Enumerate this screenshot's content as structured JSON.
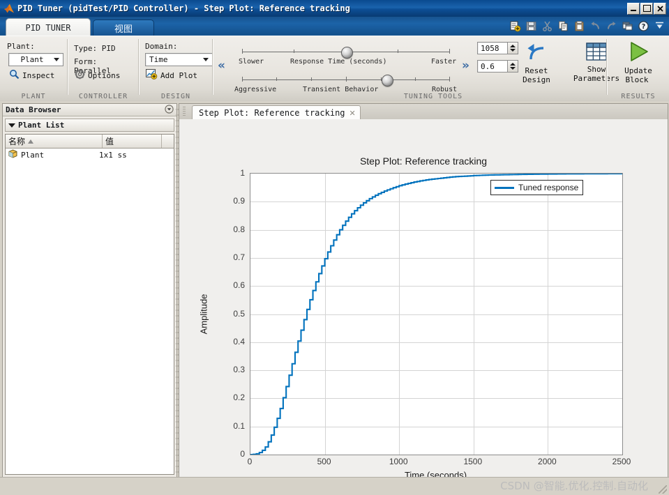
{
  "window": {
    "title": "PID Tuner  (pidTest/PID Controller) - Step Plot: Reference tracking",
    "icon": "matlab-logo-icon",
    "minimize": "_",
    "maximize": "□",
    "close": "✕"
  },
  "ribbon": {
    "tabs": [
      {
        "label": "PID TUNER",
        "active": true
      },
      {
        "label": "视图",
        "active": false
      }
    ],
    "quick_access": [
      "new-icon",
      "save-icon",
      "cut-icon",
      "copy-icon",
      "paste-icon",
      "undo-icon",
      "redo-icon",
      "window-icon",
      "help-icon",
      "collapse-ribbon-icon"
    ],
    "groups": [
      {
        "name": "PLANT",
        "label": "Plant:",
        "combo_value": "Plant",
        "inspect_label": "Inspect",
        "inspect_icon": "magnifier-icon"
      },
      {
        "name": "CONTROLLER",
        "type_label": "Type:",
        "type_value": "PID",
        "form_label": "Form:",
        "form_value": "Parallel",
        "options_label": "Options",
        "options_icon": "gear-icon"
      },
      {
        "name": "DESIGN",
        "domain_label": "Domain:",
        "domain_value": "Time",
        "add_plot_label": "Add Plot",
        "add_plot_icon": "plot-add-icon"
      },
      {
        "name": "TUNING TOOLS",
        "slider1": {
          "left_label": "Slower",
          "center_label": "Response Time (seconds)",
          "right_label": "Faster",
          "position_pct": 50
        },
        "slider2": {
          "left_label": "Aggressive",
          "center_label": "Transient Behavior",
          "right_label": "Robust",
          "position_pct": 72
        },
        "left_chevron": "«",
        "right_chevron": "»",
        "response_time_value": "1058",
        "transient_value": "0.6",
        "reset_design_line1": "Reset",
        "reset_design_line2": "Design",
        "reset_icon": "undo-arrow-icon",
        "show_parameters_line1": "Show",
        "show_parameters_line2": "Parameters",
        "show_parameters_icon": "table-icon"
      },
      {
        "name": "RESULTS",
        "update_block_line1": "Update",
        "update_block_line2": "Block",
        "update_icon": "green-play-icon"
      }
    ]
  },
  "data_browser": {
    "title": "Data Browser",
    "collapse_icon": "panel-collapse-icon",
    "section": "Plant List",
    "columns": [
      "名称",
      "值",
      ""
    ],
    "rows": [
      {
        "icon": "model-cube-icon",
        "name": "Plant",
        "value": "1x1 ss"
      }
    ]
  },
  "document": {
    "tab_label": "Step Plot: Reference tracking",
    "close_icon": "close-tab-icon"
  },
  "chart_data": {
    "type": "line",
    "title": "Step Plot: Reference tracking",
    "xlabel": "Time (seconds)",
    "ylabel": "Amplitude",
    "xlim": [
      0,
      2500
    ],
    "ylim": [
      0,
      1
    ],
    "xticks": [
      0,
      500,
      1000,
      1500,
      2000,
      2500
    ],
    "yticks": [
      0,
      0.1,
      0.2,
      0.3,
      0.4,
      0.5,
      0.6,
      0.7,
      0.8,
      0.9,
      1
    ],
    "grid": true,
    "legend_position": "top-right",
    "series": [
      {
        "name": "Tuned response",
        "color": "#0072BD",
        "x": [
          0,
          25,
          50,
          75,
          100,
          125,
          150,
          175,
          200,
          225,
          250,
          275,
          300,
          325,
          350,
          375,
          400,
          425,
          450,
          475,
          500,
          525,
          550,
          575,
          600,
          625,
          650,
          675,
          700,
          725,
          750,
          775,
          800,
          850,
          900,
          950,
          1000,
          1050,
          1100,
          1150,
          1200,
          1250,
          1300,
          1350,
          1400,
          1450,
          1500,
          1600,
          1700,
          1800,
          1900,
          2000,
          2100,
          2200,
          2300,
          2400,
          2500
        ],
        "y": [
          0,
          0.001,
          0.004,
          0.012,
          0.027,
          0.05,
          0.082,
          0.12,
          0.164,
          0.212,
          0.262,
          0.313,
          0.364,
          0.414,
          0.462,
          0.508,
          0.551,
          0.592,
          0.63,
          0.665,
          0.697,
          0.727,
          0.754,
          0.778,
          0.8,
          0.82,
          0.838,
          0.854,
          0.868,
          0.881,
          0.892,
          0.902,
          0.911,
          0.926,
          0.938,
          0.948,
          0.957,
          0.964,
          0.97,
          0.975,
          0.979,
          0.982,
          0.985,
          0.988,
          0.99,
          0.991,
          0.993,
          0.995,
          0.996,
          0.997,
          0.998,
          0.9985,
          0.999,
          0.9993,
          0.9995,
          0.9997,
          0.9998
        ]
      }
    ]
  },
  "watermark": "CSDN @智能.优化.控制.自动化"
}
